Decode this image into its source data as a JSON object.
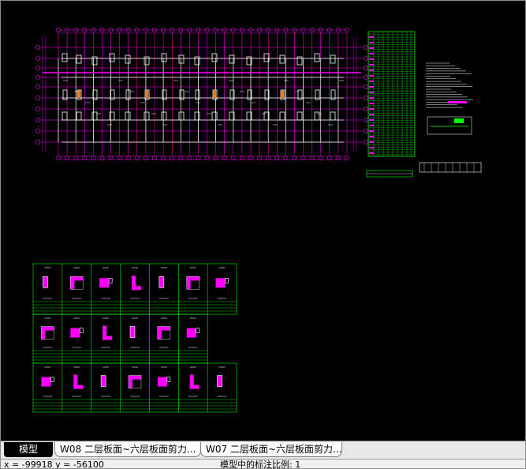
{
  "tabs": [
    {
      "label": "模型",
      "active": true
    },
    {
      "label": "W08 二层板面~六层板面剪力...",
      "active": false
    },
    {
      "label": "W07 二层板面~六层板面剪力...",
      "active": false
    }
  ],
  "status": {
    "coordinates": "x = -99918  y = -56100",
    "annotation_scale": "模型中的标注比例: 1"
  },
  "colors": {
    "background": "#000000",
    "axis_lines": "#ff00ff",
    "walls": "#ffffff",
    "tables": "#00ff00",
    "highlight": "#ff00ff"
  }
}
